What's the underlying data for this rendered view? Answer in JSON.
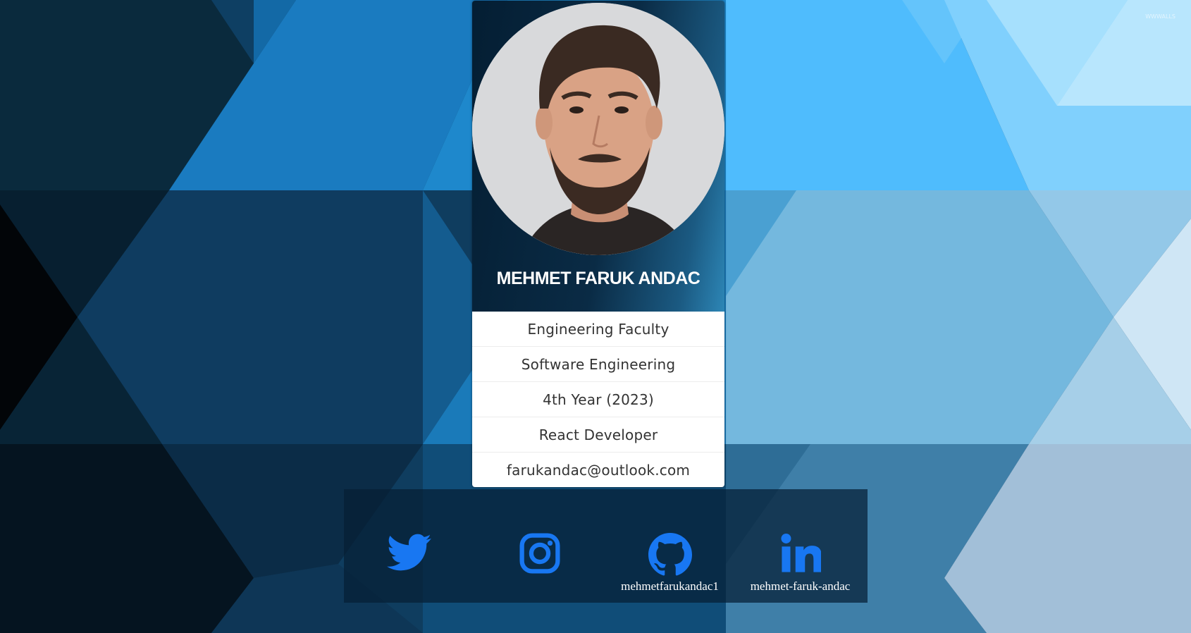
{
  "watermark": "WWWALLS",
  "profile": {
    "photo_alt": "Profile photo",
    "name": "MEHMET FARUK ANDAC"
  },
  "info": [
    "Engineering Faculty",
    "Software Engineering",
    "4th Year (2023)",
    "React Developer",
    "farukandac@outlook.com"
  ],
  "social": [
    {
      "icon": "twitter-icon",
      "handle": ""
    },
    {
      "icon": "instagram-icon",
      "handle": ""
    },
    {
      "icon": "github-icon",
      "handle": "mehmetfarukandac1"
    },
    {
      "icon": "linkedin-icon",
      "handle": "mehmet-faruk-andac"
    }
  ],
  "colors": {
    "icon_blue": "#1877f2",
    "card_dark": "#0a2b45",
    "bg_light": "#4fbcfd",
    "bg_dark": "#061624"
  }
}
